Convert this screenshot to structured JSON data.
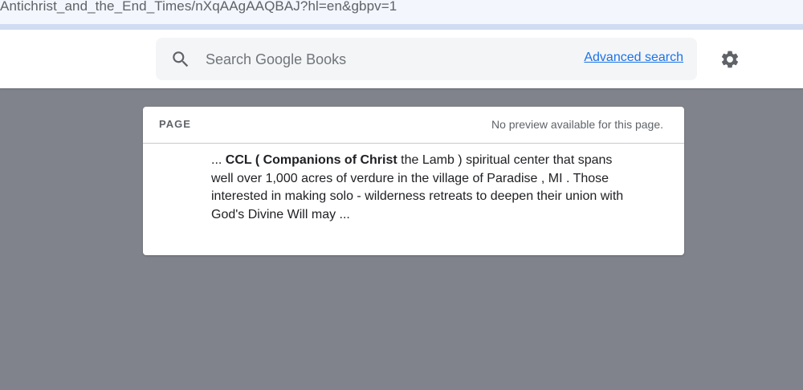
{
  "browser": {
    "url_fragment": "Antichrist_and_the_End_Times/nXqAAgAAQBAJ?hl=en&gbpv=1"
  },
  "header": {
    "search": {
      "placeholder": "Search Google Books",
      "value": "",
      "icon": "search-icon"
    },
    "advanced_search_label": "Advanced search",
    "settings_icon": "gear-icon",
    "link_color": "#1a73e8"
  },
  "result_card": {
    "section_label": "PAGE",
    "status_text": "No preview available for this page.",
    "snippet": {
      "lead": "... ",
      "bold": "CCL ( Companions of Christ",
      "rest": " the Lamb ) spiritual center that spans well over 1,000 acres of verdure in the village of Paradise , MI . Those interested in making solo - wilderness retreats to deepen their union with God's Divine Will may ..."
    }
  },
  "colors": {
    "page_background": "#80838b",
    "card_background": "#ffffff",
    "search_background": "#f4f5f7"
  }
}
